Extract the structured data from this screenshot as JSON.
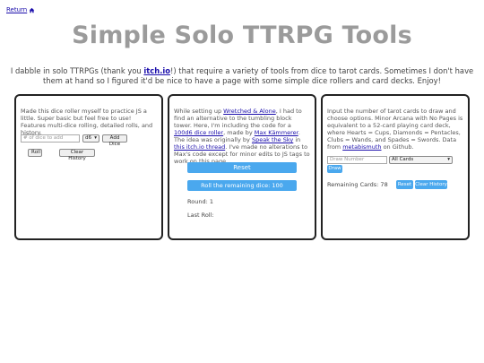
{
  "nav": {
    "return_label": "Return",
    "home_icon": "home-icon"
  },
  "header": {
    "title": "Simple Solo TTRPG Tools"
  },
  "intro": {
    "part1": "I dabble in solo TTRPGs (thank you ",
    "link": "itch.io",
    "part2": "!) that require a variety of tools from dice to tarot cards. Sometimes I don't have them at hand so I figured it'd be nice to have a page with some simple dice rollers and card decks. Enjoy!"
  },
  "dice_panel": {
    "description": "Made this dice roller myself to practice JS a little. Super basic but feel free to use! Features multi-dice rolling, detailed rolls, and history.",
    "num_dice_placeholder": "# of dice to add",
    "die_type": "d6",
    "add_dice_label": "Add Dice",
    "roll_label": "Roll",
    "clear_history_label": "Clear History"
  },
  "tower_panel": {
    "d1": "While setting up ",
    "link_wretched": "Wretched & Alone",
    "d2": ", I had to find an alternative to the tumbling block tower. Here, I'm including the code for a ",
    "link_roller": "100d6 dice roller",
    "d3": ", made by ",
    "link_max": "Max Kämmerer",
    "d4": ". The idea was originally by ",
    "link_speak": "Speak the Sky",
    "d5": " in ",
    "link_thread": "this itch.io thread",
    "d6": ". I've made no alterations to Max's code except for minor edits to JS tags to work on this page.",
    "reset_label": "Reset",
    "roll_remaining_label": "Roll the remaining dice: 100",
    "round_label": "Round: 1",
    "last_roll_label": "Last Roll:"
  },
  "tarot_panel": {
    "d1": "Input the number of tarot cards to draw and choose options. Minor Arcana with No Pages is equivalent to a 52-card playing card deck, where Hearts = Cups, Diamonds = Pentacles, Clubs = Wands, and Spades = Swords. Data from ",
    "link_metabismuth": "metabismuth",
    "d2": " on Github.",
    "draw_number_placeholder": "Draw Number",
    "card_option": "All Cards",
    "draw_label": "Draw",
    "remaining_label": "Remaining Cards: 78",
    "reset_label": "Reset",
    "clear_history_label": "Clear History"
  },
  "colors": {
    "accent": "#4aa8ee",
    "title": "#9b9b9b",
    "link": "#1a0dab"
  }
}
